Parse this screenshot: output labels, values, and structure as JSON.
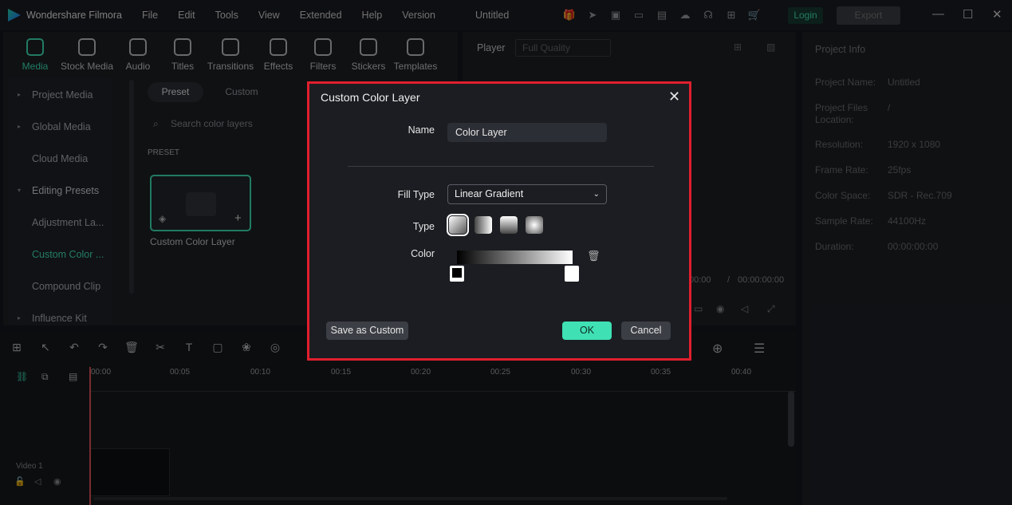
{
  "app": {
    "name": "Wondershare Filmora",
    "doc_title": "Untitled"
  },
  "menu": [
    "File",
    "Edit",
    "Tools",
    "View",
    "Extended",
    "Help",
    "Version"
  ],
  "header": {
    "login": "Login",
    "export": "Export"
  },
  "toolbar": [
    "Media",
    "Stock Media",
    "Audio",
    "Titles",
    "Transitions",
    "Effects",
    "Filters",
    "Stickers",
    "Templates"
  ],
  "sidebar": [
    {
      "label": "Project Media",
      "caret": "▸"
    },
    {
      "label": "Global Media",
      "caret": "▸"
    },
    {
      "label": "Cloud Media",
      "caret": ""
    },
    {
      "label": "Editing Presets",
      "caret": "▾"
    },
    {
      "label": "Adjustment La...",
      "caret": ""
    },
    {
      "label": "Custom Color ...",
      "caret": ""
    },
    {
      "label": "Compound Clip",
      "caret": ""
    },
    {
      "label": "Influence Kit",
      "caret": "▸"
    }
  ],
  "media": {
    "tab_preset": "Preset",
    "tab_custom": "Custom",
    "search_placeholder": "Search color layers",
    "section": "PRESET",
    "card_label": "Custom Color Layer"
  },
  "player": {
    "label": "Player",
    "quality": "Full Quality",
    "time_current": "00:00",
    "time_sep": "/",
    "time_total": "00:00:00:00"
  },
  "project_info": {
    "title": "Project Info",
    "rows": [
      {
        "k": "Project Name:",
        "v": "Untitled"
      },
      {
        "k": "Project Files Location:",
        "v": "/"
      },
      {
        "k": "Resolution:",
        "v": "1920 x 1080"
      },
      {
        "k": "Frame Rate:",
        "v": "25fps"
      },
      {
        "k": "Color Space:",
        "v": "SDR - Rec.709"
      },
      {
        "k": "Sample Rate:",
        "v": "44100Hz"
      },
      {
        "k": "Duration:",
        "v": "00:00:00:00"
      }
    ]
  },
  "timeline": {
    "ticks": [
      "00:00",
      "00:05",
      "00:10",
      "00:15",
      "00:20",
      "00:25",
      "00:30",
      "00:35",
      "00:40"
    ],
    "track": "Video 1"
  },
  "dialog": {
    "title": "Custom Color Layer",
    "name_label": "Name",
    "name_value": "Color Layer",
    "fill_label": "Fill Type",
    "fill_value": "Linear Gradient",
    "type_label": "Type",
    "color_label": "Color",
    "save_custom": "Save as Custom",
    "ok": "OK",
    "cancel": "Cancel"
  },
  "colors": {
    "accent": "#3fe0b4",
    "highlight": "#e01f2e"
  }
}
